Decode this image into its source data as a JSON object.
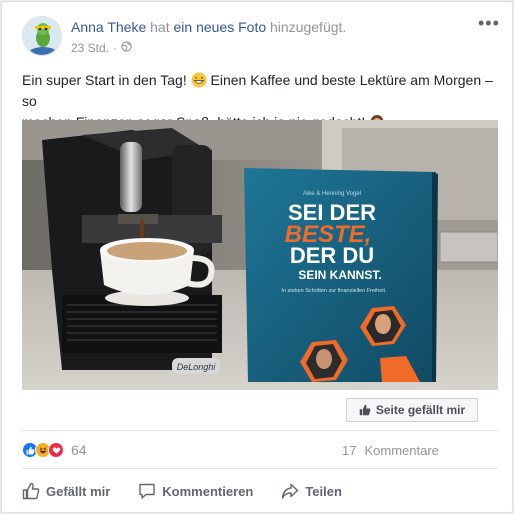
{
  "post": {
    "author": "Anna Theke",
    "activity_prefix": "hat",
    "activity_link": "ein neues Foto",
    "activity_suffix": "hinzugefügt.",
    "time": "23 Std.",
    "separator": "·",
    "privacy_icon": "globe-icon",
    "more_icon": "more-dots-icon",
    "text_line1_part1": "Ein super Start in den Tag!",
    "text_line1_emoji": "grinning-face-emoji",
    "text_line1_part2": "Einen Kaffee und beste Lektüre am Morgen – so",
    "text_line2": "machen Finanzen sogar Spaß, hätte ich ja nie gedacht!",
    "text_line2_emoji": "person-emoji"
  },
  "photo": {
    "book_authors": "Aike & Henning Vogel",
    "book_title_line1": "SEI DER",
    "book_title_line2": "BESTE,",
    "book_title_line3": "DER DU",
    "book_title_line4": "SEIN KANNST.",
    "book_subtitle": "In sieben Schritten zur finanziellen Freiheit.",
    "machine_brand": "DeLonghi"
  },
  "page_like": {
    "label": "Seite gefällt mir",
    "icon": "thumbs-up-icon"
  },
  "stats": {
    "reaction_icons": [
      "like-reaction-icon",
      "haha-reaction-icon",
      "love-reaction-icon"
    ],
    "reaction_count": "64",
    "comment_count": "17",
    "comment_label": "Kommentare"
  },
  "actions": [
    {
      "label": "Gefällt mir",
      "icon": "thumbs-up-icon"
    },
    {
      "label": "Kommentieren",
      "icon": "comment-icon"
    },
    {
      "label": "Teilen",
      "icon": "share-icon"
    }
  ],
  "colors": {
    "link": "#365899",
    "muted": "#90949c",
    "like_blue": "#1877f2",
    "love_red": "#f0284a",
    "haha_yellow": "#f7b125",
    "book_blue": "#1b6f8e",
    "book_orange": "#f06a28"
  }
}
